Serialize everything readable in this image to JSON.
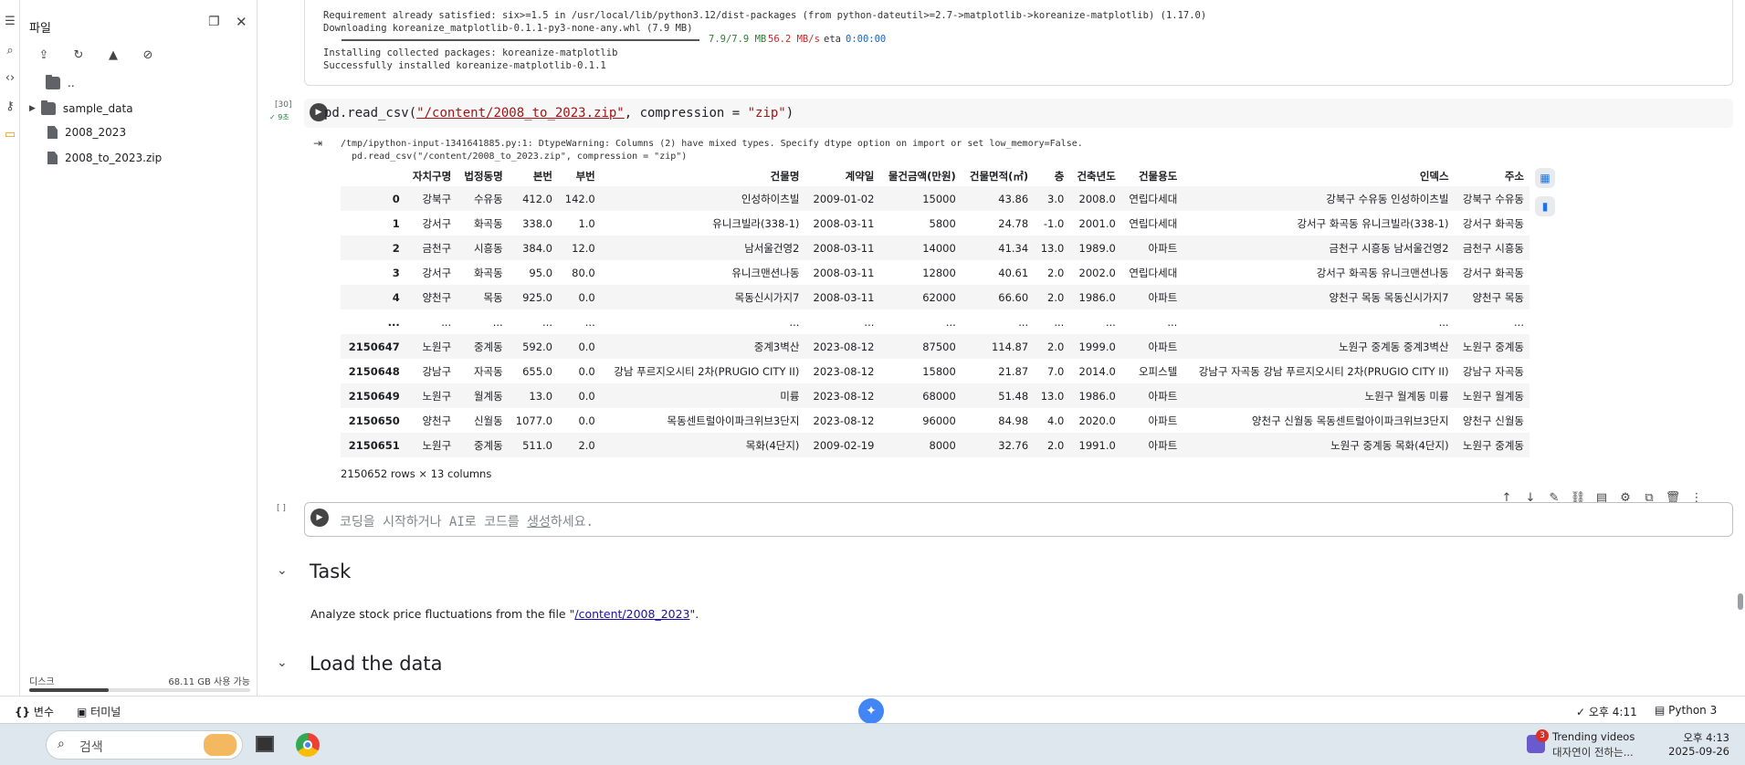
{
  "sidebar": {
    "title": "파일",
    "tree": [
      {
        "name": "..",
        "type": "folder"
      },
      {
        "name": "sample_data",
        "type": "folder"
      },
      {
        "name": "2008_2023",
        "type": "file"
      },
      {
        "name": "2008_to_2023.zip",
        "type": "file"
      }
    ],
    "disk_label": "디스크",
    "disk_usage": "68.11 GB 사용 가능",
    "disk_fraction": 0.36
  },
  "pip_output": [
    "Requirement already satisfied: six>=1.5 in /usr/local/lib/python3.12/dist-packages (from python-dateutil>=2.7->matplotlib->koreanize-matplotlib) (1.17.0)",
    "Downloading koreanize_matplotlib-0.1.1-py3-none-any.whl (7.9 MB)"
  ],
  "pip_progress": {
    "amount": "7.9/7.9 MB",
    "speed": "56.2 MB/s",
    "eta_label": "eta",
    "eta": "0:00:00",
    "fraction": 1.0
  },
  "pip_tail": [
    "Installing collected packages: koreanize-matplotlib",
    "Successfully installed koreanize-matplotlib-0.1.1"
  ],
  "cell": {
    "exec_count": "[30]",
    "exec_time": "✓ 9초",
    "code_prefix": "pd.read_csv(",
    "code_path": "\"/content/2008_to_2023.zip\"",
    "code_mid": ", compression = ",
    "code_arg": "\"zip\"",
    "code_suffix": ")",
    "warning": [
      "/tmp/ipython-input-1341641885.py:1: DtypeWarning: Columns (2) have mixed types. Specify dtype option on import or set low_memory=False.",
      "  pd.read_csv(\"/content/2008_to_2023.zip\", compression = \"zip\")"
    ],
    "table": {
      "columns": [
        "",
        "자치구명",
        "법정동명",
        "본번",
        "부번",
        "건물명",
        "계약일",
        "물건금액(만원)",
        "건물면적(㎡)",
        "층",
        "건축년도",
        "건물용도",
        "인덱스",
        "주소"
      ],
      "rows": [
        [
          "0",
          "강북구",
          "수유동",
          "412.0",
          "142.0",
          "인성하이츠빌",
          "2009-01-02",
          "15000",
          "43.86",
          "3.0",
          "2008.0",
          "연립다세대",
          "강북구 수유동 인성하이츠빌",
          "강북구 수유동"
        ],
        [
          "1",
          "강서구",
          "화곡동",
          "338.0",
          "1.0",
          "유니크빌라(338-1)",
          "2008-03-11",
          "5800",
          "24.78",
          "-1.0",
          "2001.0",
          "연립다세대",
          "강서구 화곡동 유니크빌라(338-1)",
          "강서구 화곡동"
        ],
        [
          "2",
          "금천구",
          "시흥동",
          "384.0",
          "12.0",
          "남서울건영2",
          "2008-03-11",
          "14000",
          "41.34",
          "13.0",
          "1989.0",
          "아파트",
          "금천구 시흥동 남서울건영2",
          "금천구 시흥동"
        ],
        [
          "3",
          "강서구",
          "화곡동",
          "95.0",
          "80.0",
          "유니크맨션나동",
          "2008-03-11",
          "12800",
          "40.61",
          "2.0",
          "2002.0",
          "연립다세대",
          "강서구 화곡동 유니크맨션나동",
          "강서구 화곡동"
        ],
        [
          "4",
          "양천구",
          "목동",
          "925.0",
          "0.0",
          "목동신시가지7",
          "2008-03-11",
          "62000",
          "66.60",
          "2.0",
          "1986.0",
          "아파트",
          "양천구 목동 목동신시가지7",
          "양천구 목동"
        ],
        [
          "...",
          "...",
          "...",
          "...",
          "...",
          "...",
          "...",
          "...",
          "...",
          "...",
          "...",
          "...",
          "...",
          "..."
        ],
        [
          "2150647",
          "노원구",
          "중계동",
          "592.0",
          "0.0",
          "중계3벽산",
          "2023-08-12",
          "87500",
          "114.87",
          "2.0",
          "1999.0",
          "아파트",
          "노원구 중계동 중계3벽산",
          "노원구 중계동"
        ],
        [
          "2150648",
          "강남구",
          "자곡동",
          "655.0",
          "0.0",
          "강남 푸르지오시티 2차(PRUGIO CITY II)",
          "2023-08-12",
          "15800",
          "21.87",
          "7.0",
          "2014.0",
          "오피스텔",
          "강남구 자곡동 강남 푸르지오시티 2차(PRUGIO CITY II)",
          "강남구 자곡동"
        ],
        [
          "2150649",
          "노원구",
          "월계동",
          "13.0",
          "0.0",
          "미륭",
          "2023-08-12",
          "68000",
          "51.48",
          "13.0",
          "1986.0",
          "아파트",
          "노원구 월계동 미륭",
          "노원구 월계동"
        ],
        [
          "2150650",
          "양천구",
          "신월동",
          "1077.0",
          "0.0",
          "목동센트럴아이파크위브3단지",
          "2023-08-12",
          "96000",
          "84.98",
          "4.0",
          "2020.0",
          "아파트",
          "양천구 신월동 목동센트럴아이파크위브3단지",
          "양천구 신월동"
        ],
        [
          "2150651",
          "노원구",
          "중계동",
          "511.0",
          "2.0",
          "목화(4단지)",
          "2009-02-19",
          "8000",
          "32.76",
          "2.0",
          "1991.0",
          "아파트",
          "노원구 중계동 목화(4단지)",
          "노원구 중계동"
        ]
      ],
      "shape": "2150652 rows × 13 columns"
    }
  },
  "empty_cell": {
    "exec_count": "[ ]",
    "placeholder_a": "코딩을 시작하거나 AI로 코드를 ",
    "placeholder_link": "생성",
    "placeholder_b": "하세요."
  },
  "sections": [
    {
      "title": "Task",
      "body_a": "Analyze stock price fluctuations from the file \"",
      "body_link": "/content/2008_2023",
      "body_b": "\"."
    },
    {
      "title": "Load the data"
    }
  ],
  "statusbar": {
    "variables": "변수",
    "terminal": "터미널",
    "saved_time": "✓ 오후 4:11",
    "runtime": "Python 3"
  },
  "taskbar": {
    "search_placeholder": "검색",
    "badge": "3",
    "news_title": "Trending videos",
    "news_sub": "대자연이 전하는...",
    "time": "오후 4:13",
    "date": "2025-09-26"
  }
}
